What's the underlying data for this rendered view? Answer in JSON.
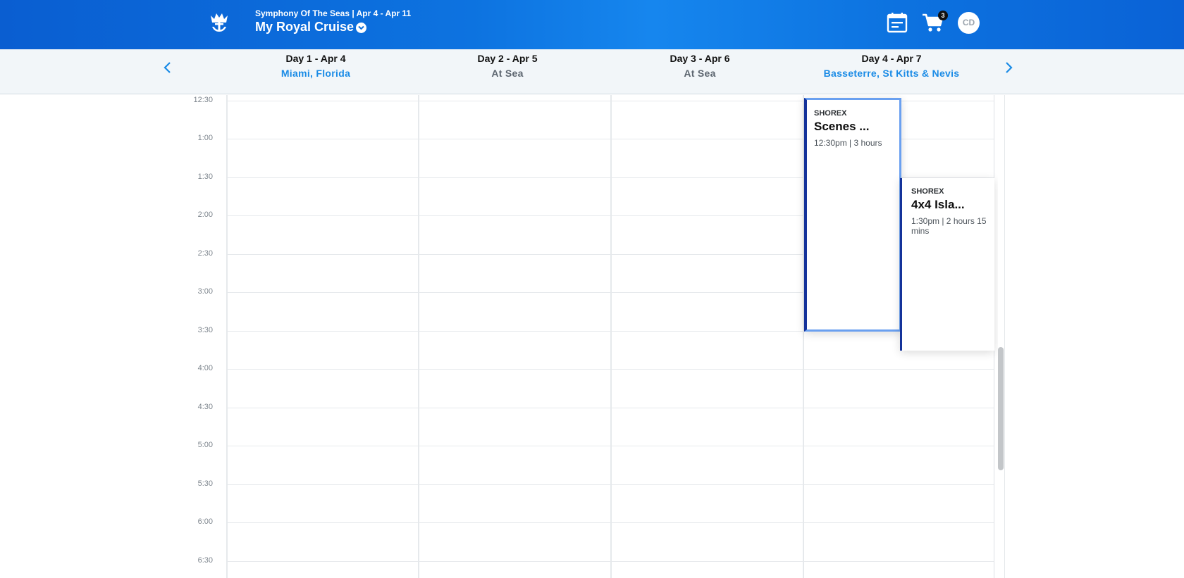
{
  "header": {
    "subtitle": "Symphony Of The Seas | Apr 4 - Apr 11",
    "title": "My Royal Cruise",
    "cart_count": "3",
    "user_initials": "CD",
    "icons": {
      "logo": "royal-caribbean-crown-anchor",
      "dropdown": "chevron-down-circle",
      "calendar": "calendar-list",
      "cart": "shopping-cart",
      "prev": "chevron-left",
      "next": "chevron-right"
    }
  },
  "days": [
    {
      "title": "Day 1 - Apr 4",
      "port": "Miami, Florida",
      "highlight": true
    },
    {
      "title": "Day 2 - Apr 5",
      "port": "At Sea",
      "highlight": false
    },
    {
      "title": "Day 3 - Apr 6",
      "port": "At Sea",
      "highlight": false
    },
    {
      "title": "Day 4 - Apr 7",
      "port": "Basseterre, St Kitts & Nevis",
      "highlight": true
    }
  ],
  "times": [
    "12:30",
    "1:00",
    "1:30",
    "2:00",
    "2:30",
    "3:00",
    "3:30",
    "4:00",
    "4:30",
    "5:00",
    "5:30",
    "6:00",
    "6:30"
  ],
  "events": [
    {
      "category": "SHOREX",
      "name": "Scenes ...",
      "time": "12:30pm | 3 hours"
    },
    {
      "category": "SHOREX",
      "name": "4x4 Isla...",
      "time": "1:30pm | 2 hours 15 mins"
    }
  ],
  "colors": {
    "header_blue": "#0d73e0",
    "port_blue": "#1a8be6",
    "event_border": "#14329a",
    "event_selected": "#6aa0f0"
  }
}
